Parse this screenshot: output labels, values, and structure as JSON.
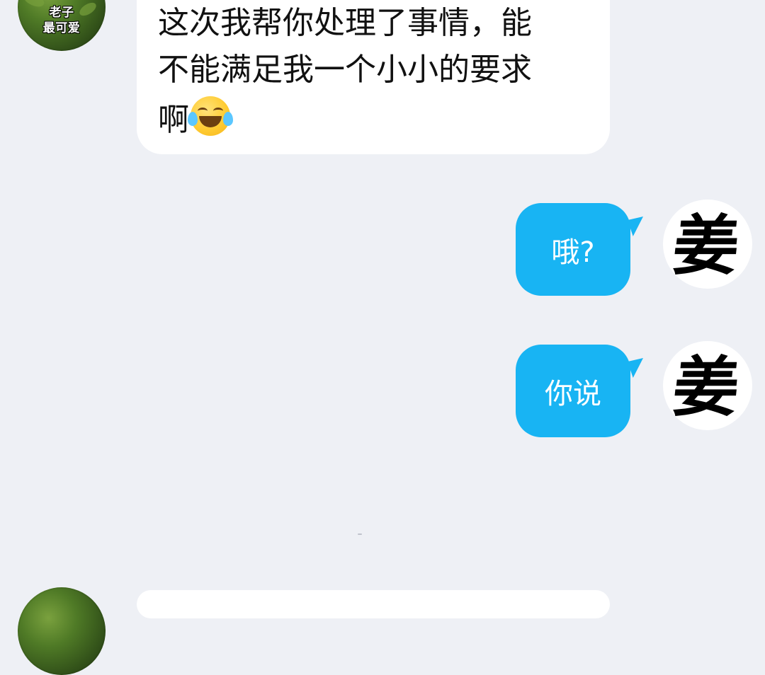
{
  "chat": {
    "received_1": {
      "avatar_caption_line1": "老子",
      "avatar_caption_line2": "最可爱",
      "lines": [
        "这次我帮你处理了事情，能",
        "不能满足我一个小小的要求",
        "啊"
      ],
      "emoji": "tears-of-joy-emoji"
    },
    "sent": [
      {
        "text": "哦?",
        "avatar_char": "姜"
      },
      {
        "text": "你说",
        "avatar_char": "姜"
      }
    ]
  },
  "colors": {
    "background": "#eef0f5",
    "received_bubble": "#ffffff",
    "sent_bubble": "#18b4f3",
    "text_dark": "#111111",
    "text_light": "#ffffff"
  }
}
